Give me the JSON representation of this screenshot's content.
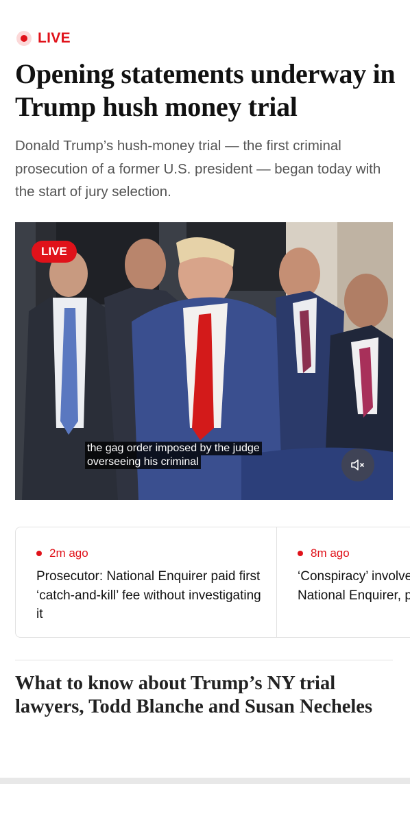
{
  "live_indicator": {
    "label": "LIVE"
  },
  "headline": "Opening statements underway in Trump hush money trial",
  "dek": "Donald Trump’s hush-money trial — the first criminal prosecution of a former U.S. president — began today with the start of jury selection.",
  "video": {
    "badge": "LIVE",
    "captions": [
      "the gag order imposed by the judge",
      "overseeing his criminal"
    ],
    "mute_icon": "speaker-muted-icon"
  },
  "updates": [
    {
      "time": "2m ago",
      "title": "Prosecutor: National Enquirer paid first ‘catch-and-kill’ fee without investigating it"
    },
    {
      "time": "8m ago",
      "title": "‘Conspiracy’ involved Trump and National Enquirer, prosecutor says"
    }
  ],
  "story": {
    "headline": "What to know about Trump’s NY trial lawyers, Todd Blanche and Susan Necheles"
  },
  "colors": {
    "accent": "#e0121a",
    "text": "#111111",
    "muted": "#555555"
  }
}
